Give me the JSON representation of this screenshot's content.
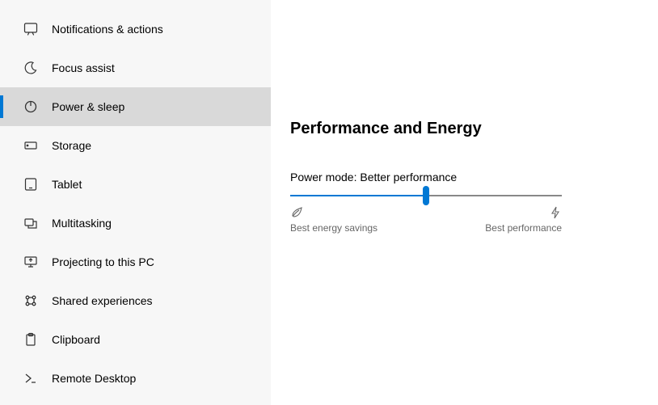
{
  "sidebar": {
    "items": [
      {
        "label": "Notifications & actions",
        "icon": "notification",
        "active": false
      },
      {
        "label": "Focus assist",
        "icon": "moon",
        "active": false
      },
      {
        "label": "Power & sleep",
        "icon": "power",
        "active": true
      },
      {
        "label": "Storage",
        "icon": "storage",
        "active": false
      },
      {
        "label": "Tablet",
        "icon": "tablet",
        "active": false
      },
      {
        "label": "Multitasking",
        "icon": "multitask",
        "active": false
      },
      {
        "label": "Projecting to this PC",
        "icon": "project",
        "active": false
      },
      {
        "label": "Shared experiences",
        "icon": "shared",
        "active": false
      },
      {
        "label": "Clipboard",
        "icon": "clipboard",
        "active": false
      },
      {
        "label": "Remote Desktop",
        "icon": "remote",
        "active": false
      }
    ]
  },
  "main": {
    "section_title": "Performance and Energy",
    "mode_label": "Power mode: Better performance",
    "slider": {
      "position_percent": 50,
      "left_label": "Best energy savings",
      "right_label": "Best performance"
    }
  },
  "colors": {
    "accent": "#0078d4"
  }
}
